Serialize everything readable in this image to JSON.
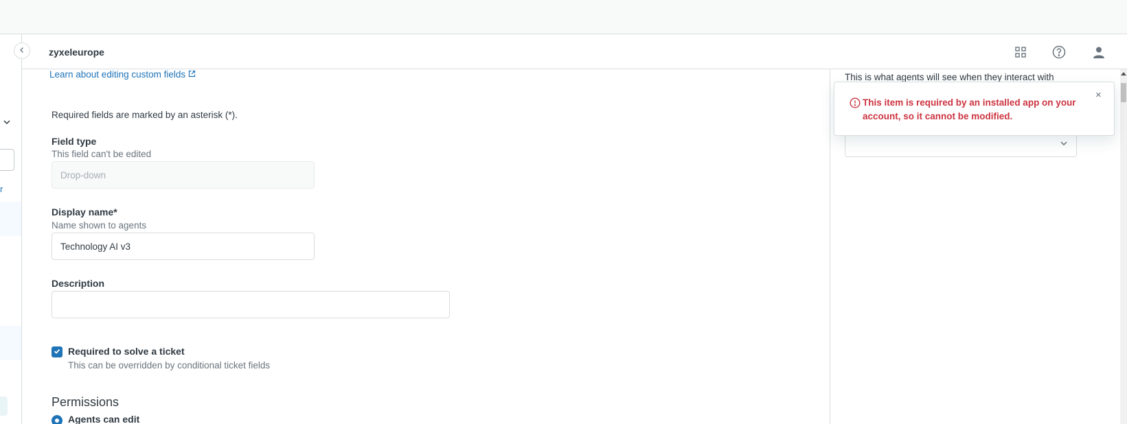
{
  "header": {
    "account_name": "zyxeleurope",
    "icons": [
      "products-grid-icon",
      "help-icon",
      "user-profile-icon"
    ]
  },
  "sidebar": {
    "link_fragment": "r"
  },
  "main": {
    "learn_link": "Learn about editing custom fields",
    "required_note": "Required fields are marked by an asterisk (*).",
    "field_type": {
      "label": "Field type",
      "hint": "This field can't be edited",
      "value": "Drop-down"
    },
    "display_name": {
      "label": "Display name*",
      "hint": "Name shown to agents",
      "value": "Technology AI v3"
    },
    "description": {
      "label": "Description",
      "value": ""
    },
    "required_solve": {
      "label": "Required to solve a ticket",
      "hint": "This can be overridden by conditional ticket fields",
      "checked": true
    },
    "permissions": {
      "title": "Permissions",
      "option_label": "Agents can edit",
      "selected": true
    }
  },
  "right_panel": {
    "text": "This is what agents will see when they interact with"
  },
  "toast": {
    "message": "This item is required by an installed app on your account, so it cannot be modified.",
    "close_glyph": "×"
  },
  "colors": {
    "accent": "#1f73b7",
    "danger": "#cc3340",
    "border": "#d8dcde",
    "muted_text": "#68737d"
  }
}
